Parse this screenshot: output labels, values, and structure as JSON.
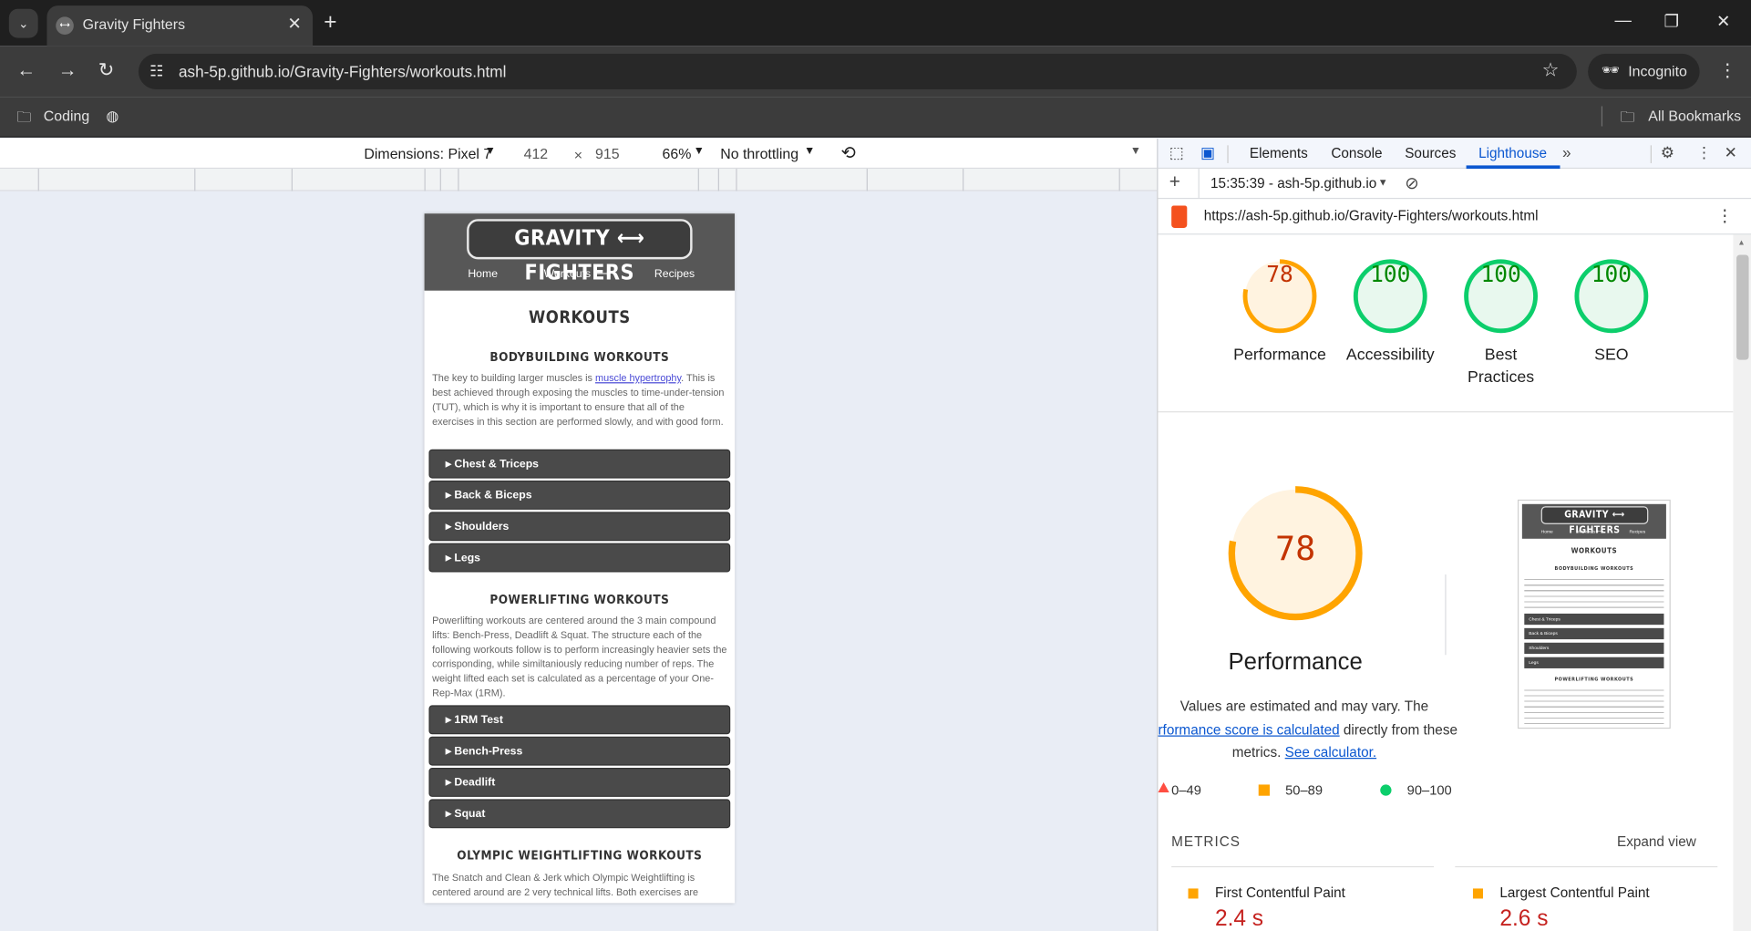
{
  "browser": {
    "tab_title": "Gravity Fighters",
    "url": "ash-5p.github.io/Gravity-Fighters/workouts.html",
    "profile": "Incognito",
    "bookmarks": [
      "Coding"
    ],
    "all_bookmarks": "All Bookmarks"
  },
  "device_toolbar": {
    "dimensions": "Dimensions: Pixel 7",
    "width": "412",
    "times": "×",
    "height": "915",
    "zoom": "66%",
    "throttle": "No throttling"
  },
  "site": {
    "logo": "GRAVITY ⟷ FIGHTERS",
    "nav": [
      "Home",
      "Workouts ⟷",
      "Recipes"
    ],
    "page_title": "WORKOUTS",
    "bodybuilding": {
      "heading": "BODYBUILDING WORKOUTS",
      "text_before": "The key to building larger muscles is ",
      "link": "muscle hypertrophy",
      "text_after": ". This is best achieved through exposing the muscles to time-under-tension (TUT), which is why it is important to ensure that all of the exercises in this section are performed slowly, and with good form.",
      "items": [
        "Chest & Triceps",
        "Back & Biceps",
        "Shoulders",
        "Legs"
      ]
    },
    "powerlifting": {
      "heading": "POWERLIFTING WORKOUTS",
      "text": "Powerlifting workouts are centered around the 3 main compound lifts: Bench-Press, Deadlift & Squat. The structure each of the following workouts follow is to perform increasingly heavier sets the corrisponding, while similtaniously reducing number of reps. The weight lifted each set is calculated as a percentage of your One-Rep-Max (1RM).",
      "items": [
        "1RM Test",
        "Bench-Press",
        "Deadlift",
        "Squat"
      ]
    },
    "olympic": {
      "heading": "OLYMPIC WEIGHTLIFTING WORKOUTS",
      "text": "The Snatch and Clean & Jerk which Olympic Weightlifting is centered around are 2 very technical lifts. Both exercises are"
    }
  },
  "devtools": {
    "tabs": [
      "Elements",
      "Console",
      "Sources",
      "Lighthouse"
    ],
    "active_tab": "Lighthouse",
    "report_selector": "15:35:39 - ash-5p.github.io",
    "report_url": "https://ash-5p.github.io/Gravity-Fighters/workouts.html",
    "scores": [
      {
        "label": "Performance",
        "score": "78",
        "value": 78,
        "color": "#ffa400",
        "text_color": "#c33300",
        "bg": "#fff3e0"
      },
      {
        "label": "Accessibility",
        "score": "100",
        "value": 100,
        "color": "#0cce6b",
        "text_color": "#008800",
        "bg": "#e8f8ee"
      },
      {
        "label": "Best\nPractices",
        "score": "100",
        "value": 100,
        "color": "#0cce6b",
        "text_color": "#008800",
        "bg": "#e8f8ee"
      },
      {
        "label": "SEO",
        "score": "100",
        "value": 100,
        "color": "#0cce6b",
        "text_color": "#008800",
        "bg": "#e8f8ee"
      }
    ],
    "perf_big_score": "78",
    "perf_big_label": "Performance",
    "estimate_text_1": "Values are estimated and may vary. The",
    "estimate_link": "rformance score is calculated",
    "estimate_text_2": " directly from these",
    "estimate_text_3": "metrics. ",
    "calculator_link": "See calculator.",
    "legend": [
      "0–49",
      "50–89",
      "90–100"
    ],
    "metrics_title": "METRICS",
    "expand": "Expand view",
    "metrics": [
      {
        "name": "First Contentful Paint",
        "value": "2.4 s"
      },
      {
        "name": "Largest Contentful Paint",
        "value": "2.6 s"
      }
    ],
    "thumb": {
      "logo": "GRAVITY ⟷ FIGHTERS",
      "nav": [
        "Home",
        "Workouts ⟷",
        "Recipes"
      ],
      "title": "WORKOUTS",
      "sub1": "BODYBUILDING WORKOUTS",
      "items": [
        "Chest & Triceps",
        "Back & Biceps",
        "Shoulders",
        "Legs"
      ],
      "sub2": "POWERLIFTING WORKOUTS"
    }
  }
}
